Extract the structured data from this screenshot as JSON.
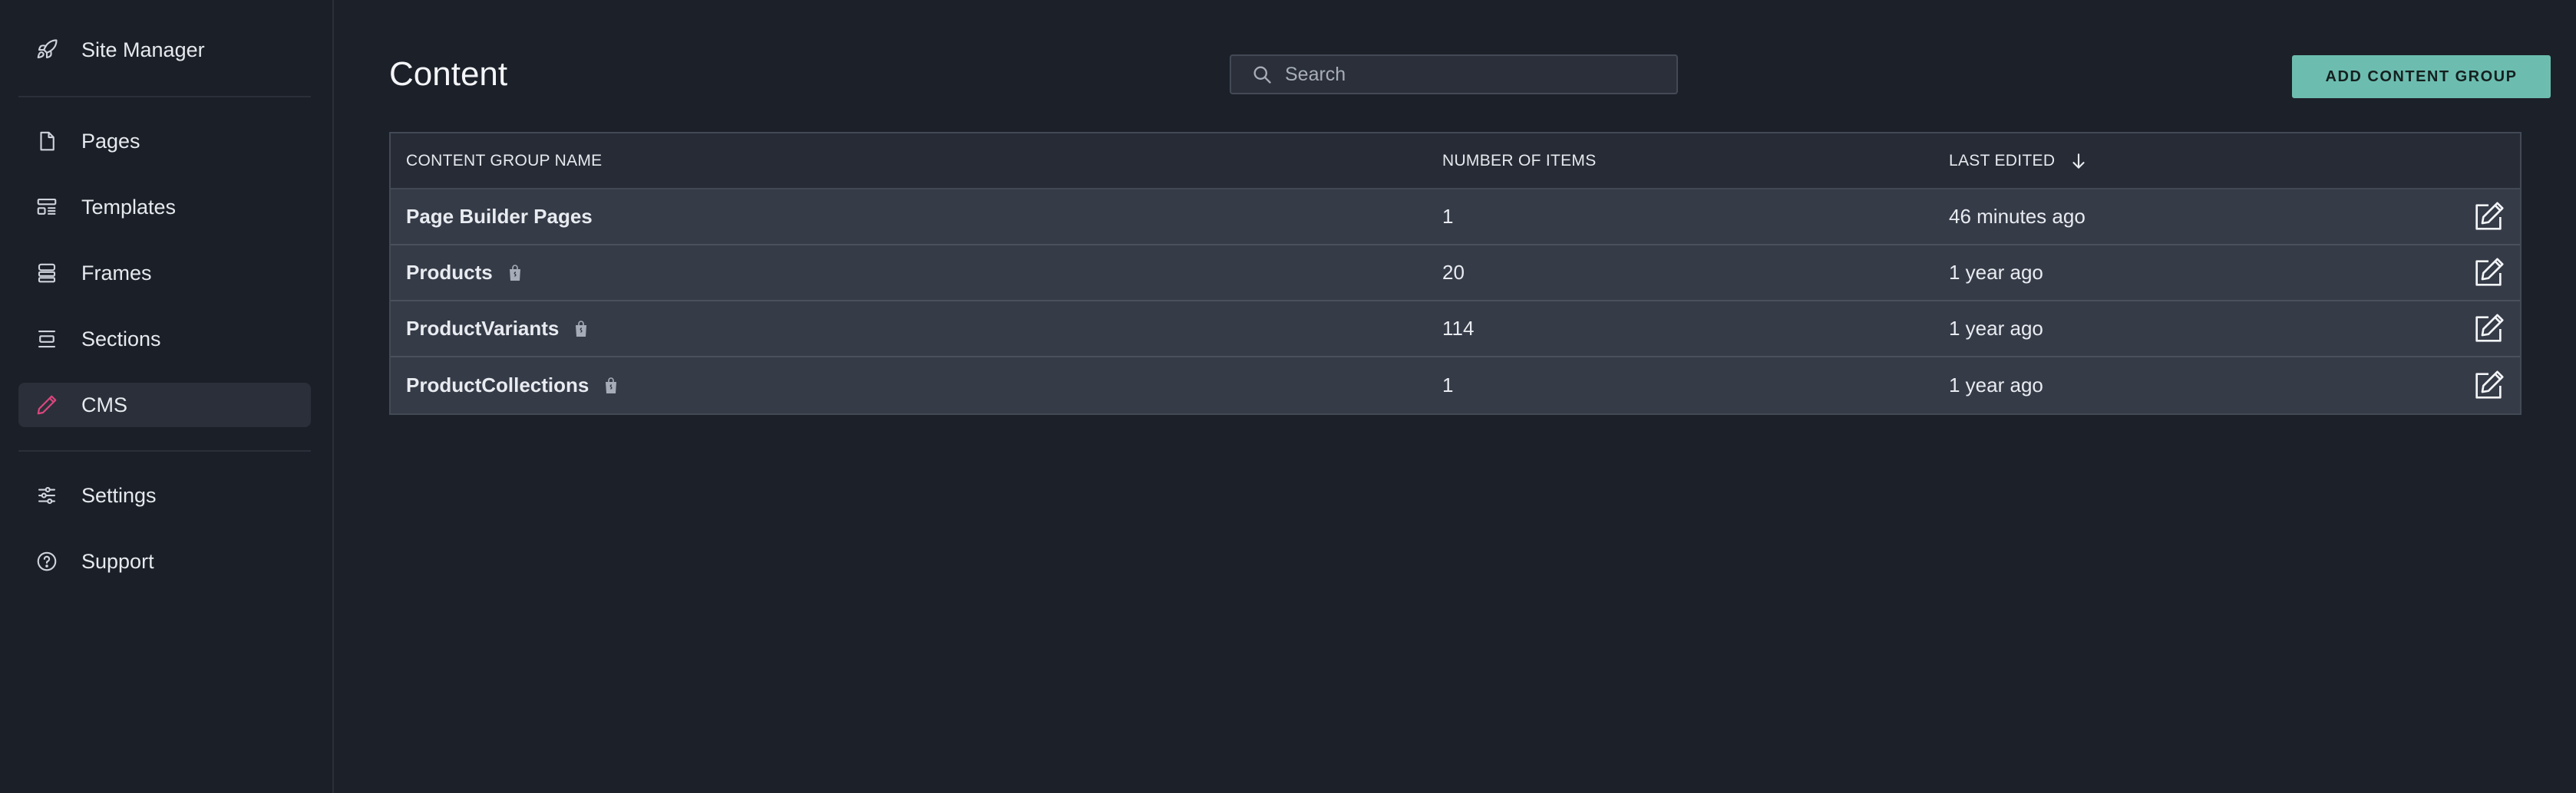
{
  "sidebar": {
    "items": [
      {
        "label": "Site Manager",
        "icon": "rocket-icon"
      },
      {
        "label": "Pages",
        "icon": "page-icon"
      },
      {
        "label": "Templates",
        "icon": "templates-icon"
      },
      {
        "label": "Frames",
        "icon": "frames-icon"
      },
      {
        "label": "Sections",
        "icon": "sections-icon"
      },
      {
        "label": "CMS",
        "icon": "pencil-icon",
        "active": true
      },
      {
        "label": "Settings",
        "icon": "sliders-icon"
      },
      {
        "label": "Support",
        "icon": "help-icon"
      }
    ]
  },
  "header": {
    "title": "Content",
    "search_placeholder": "Search",
    "add_button_label": "ADD CONTENT GROUP"
  },
  "table": {
    "columns": [
      "CONTENT GROUP NAME",
      "NUMBER OF ITEMS",
      "LAST EDITED"
    ],
    "rows": [
      {
        "name": "Page Builder Pages",
        "count": "1",
        "edited": "46 minutes ago",
        "shop_icon": false
      },
      {
        "name": "Products",
        "count": "20",
        "edited": "1 year ago",
        "shop_icon": true
      },
      {
        "name": "ProductVariants",
        "count": "114",
        "edited": "1 year ago",
        "shop_icon": true
      },
      {
        "name": "ProductCollections",
        "count": "1",
        "edited": "1 year ago",
        "shop_icon": true
      }
    ]
  },
  "colors": {
    "background": "#1c2029",
    "accent": "#6cbdb0",
    "cms_icon": "#d9467e"
  }
}
